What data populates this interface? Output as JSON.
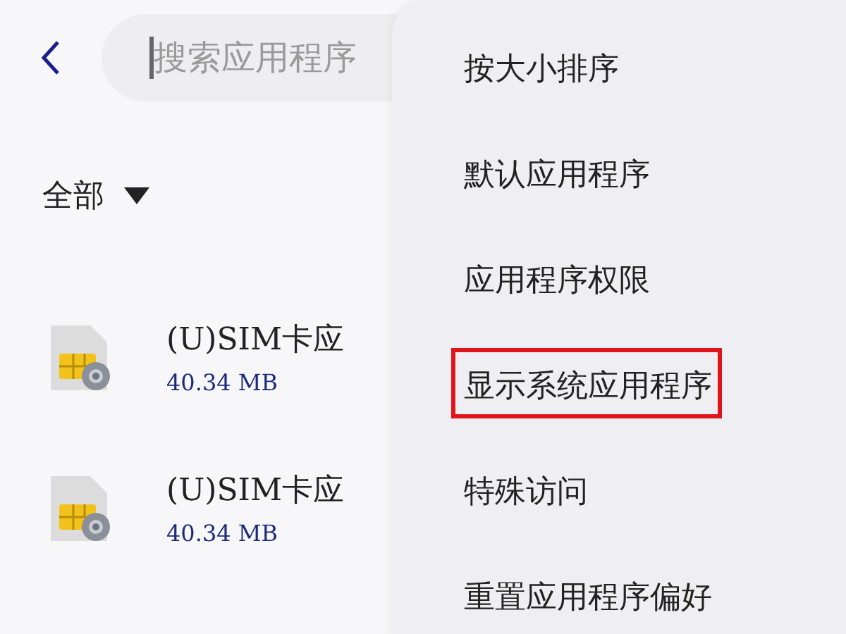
{
  "search": {
    "placeholder": "搜索应用程序"
  },
  "filter": {
    "label": "全部"
  },
  "apps": [
    {
      "name": "(U)SIM卡应",
      "size": "40.34 MB"
    },
    {
      "name": "(U)SIM卡应",
      "size": "40.34 MB"
    }
  ],
  "menu": [
    {
      "label": "按大小排序",
      "highlighted": false
    },
    {
      "label": "默认应用程序",
      "highlighted": false
    },
    {
      "label": "应用程序权限",
      "highlighted": false
    },
    {
      "label": "显示系统应用程序",
      "highlighted": true
    },
    {
      "label": "特殊访问",
      "highlighted": false
    },
    {
      "label": "重置应用程序偏好",
      "highlighted": false
    }
  ]
}
